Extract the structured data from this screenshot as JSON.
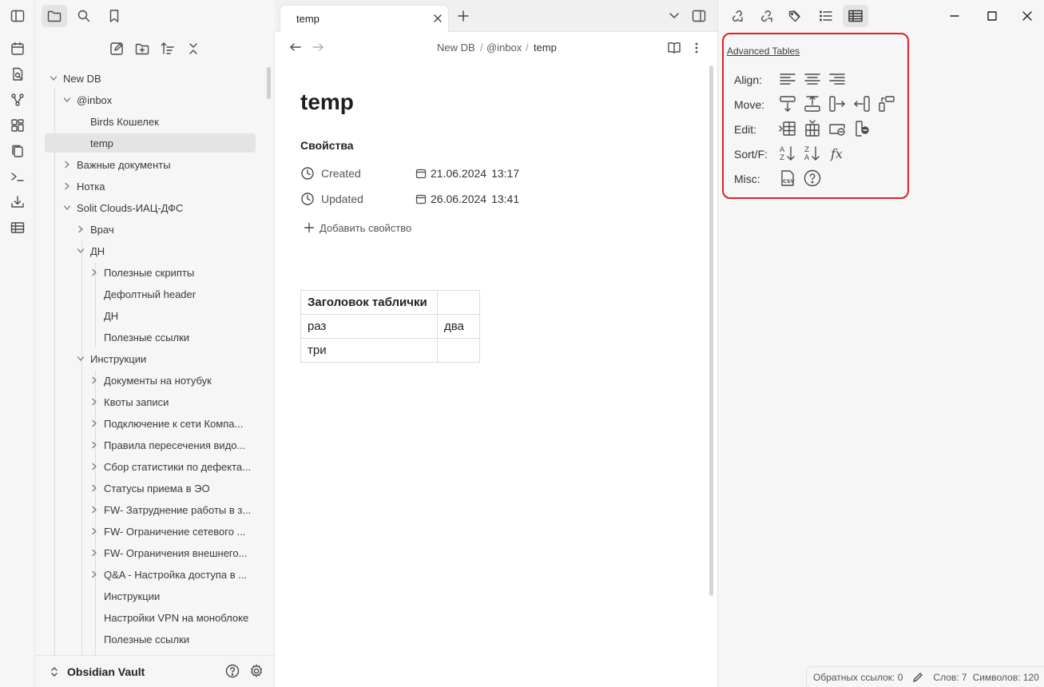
{
  "left_tree": {
    "vault_name": "New DB",
    "items": [
      {
        "label": "New DB",
        "level": 0,
        "folder": true,
        "open": true
      },
      {
        "label": "@inbox",
        "level": 1,
        "folder": true,
        "open": true
      },
      {
        "label": "Birds Кошелек",
        "level": 2,
        "folder": false
      },
      {
        "label": "temp",
        "level": 2,
        "folder": false,
        "selected": true
      },
      {
        "label": "Важные документы",
        "level": 1,
        "folder": true,
        "open": false
      },
      {
        "label": "Нотка",
        "level": 1,
        "folder": true,
        "open": false
      },
      {
        "label": "Solit Clouds-ИАЦ-ДФС",
        "level": 1,
        "folder": true,
        "open": true
      },
      {
        "label": "Врач",
        "level": 2,
        "folder": true,
        "open": false
      },
      {
        "label": "ДН",
        "level": 2,
        "folder": true,
        "open": true
      },
      {
        "label": "Полезные скрипты",
        "level": 3,
        "folder": true,
        "open": false
      },
      {
        "label": "Дефолтный header",
        "level": 3,
        "folder": false
      },
      {
        "label": "ДН",
        "level": 3,
        "folder": false
      },
      {
        "label": "Полезные ссылки",
        "level": 3,
        "folder": false
      },
      {
        "label": "Инструкции",
        "level": 2,
        "folder": true,
        "open": true
      },
      {
        "label": "Документы на нотубук",
        "level": 3,
        "folder": true,
        "open": false
      },
      {
        "label": "Квоты записи",
        "level": 3,
        "folder": true,
        "open": false
      },
      {
        "label": "Подключение к сети Компа...",
        "level": 3,
        "folder": true,
        "open": false
      },
      {
        "label": "Правила пересечения видо...",
        "level": 3,
        "folder": true,
        "open": false
      },
      {
        "label": "Сбор статистики по дефекта...",
        "level": 3,
        "folder": true,
        "open": false
      },
      {
        "label": "Статусы приема в ЭО",
        "level": 3,
        "folder": true,
        "open": false
      },
      {
        "label": "FW- Затруднение работы в з...",
        "level": 3,
        "folder": true,
        "open": false
      },
      {
        "label": "FW- Ограничение сетевого ...",
        "level": 3,
        "folder": true,
        "open": false
      },
      {
        "label": "FW- Ограничения внешнего...",
        "level": 3,
        "folder": true,
        "open": false
      },
      {
        "label": "Q&A - Настройка доступа в ...",
        "level": 3,
        "folder": true,
        "open": false
      },
      {
        "label": "Инструкции",
        "level": 3,
        "folder": false
      },
      {
        "label": "Настройки VPN на моноблоке",
        "level": 3,
        "folder": false
      },
      {
        "label": "Полезные ссылки",
        "level": 3,
        "folder": false
      }
    ]
  },
  "vault_switcher": {
    "name": "Obsidian Vault"
  },
  "tab": {
    "title": "temp"
  },
  "breadcrumb": {
    "part1": "New DB",
    "sep": "/",
    "part2": "@inbox",
    "part3": "temp"
  },
  "note": {
    "title": "temp",
    "properties_heading": "Свойства",
    "properties": [
      {
        "name": "Created",
        "date": "21.06.2024",
        "time": "13:17"
      },
      {
        "name": "Updated",
        "date": "26.06.2024",
        "time": "13:41"
      }
    ],
    "add_property": "Добавить свойство",
    "table": [
      [
        "Заголовок таблички",
        ""
      ],
      [
        "раз",
        "два"
      ],
      [
        "три",
        ""
      ]
    ]
  },
  "advanced_tables": {
    "title": "Advanced Tables",
    "rows": [
      {
        "label": "Align:"
      },
      {
        "label": "Move:"
      },
      {
        "label": "Edit:"
      },
      {
        "label": "Sort/F:"
      },
      {
        "label": "Misc:"
      }
    ]
  },
  "status": {
    "backlinks": "Обратных ссылок: 0",
    "words": "Слов: 7",
    "chars": "Символов: 120"
  }
}
